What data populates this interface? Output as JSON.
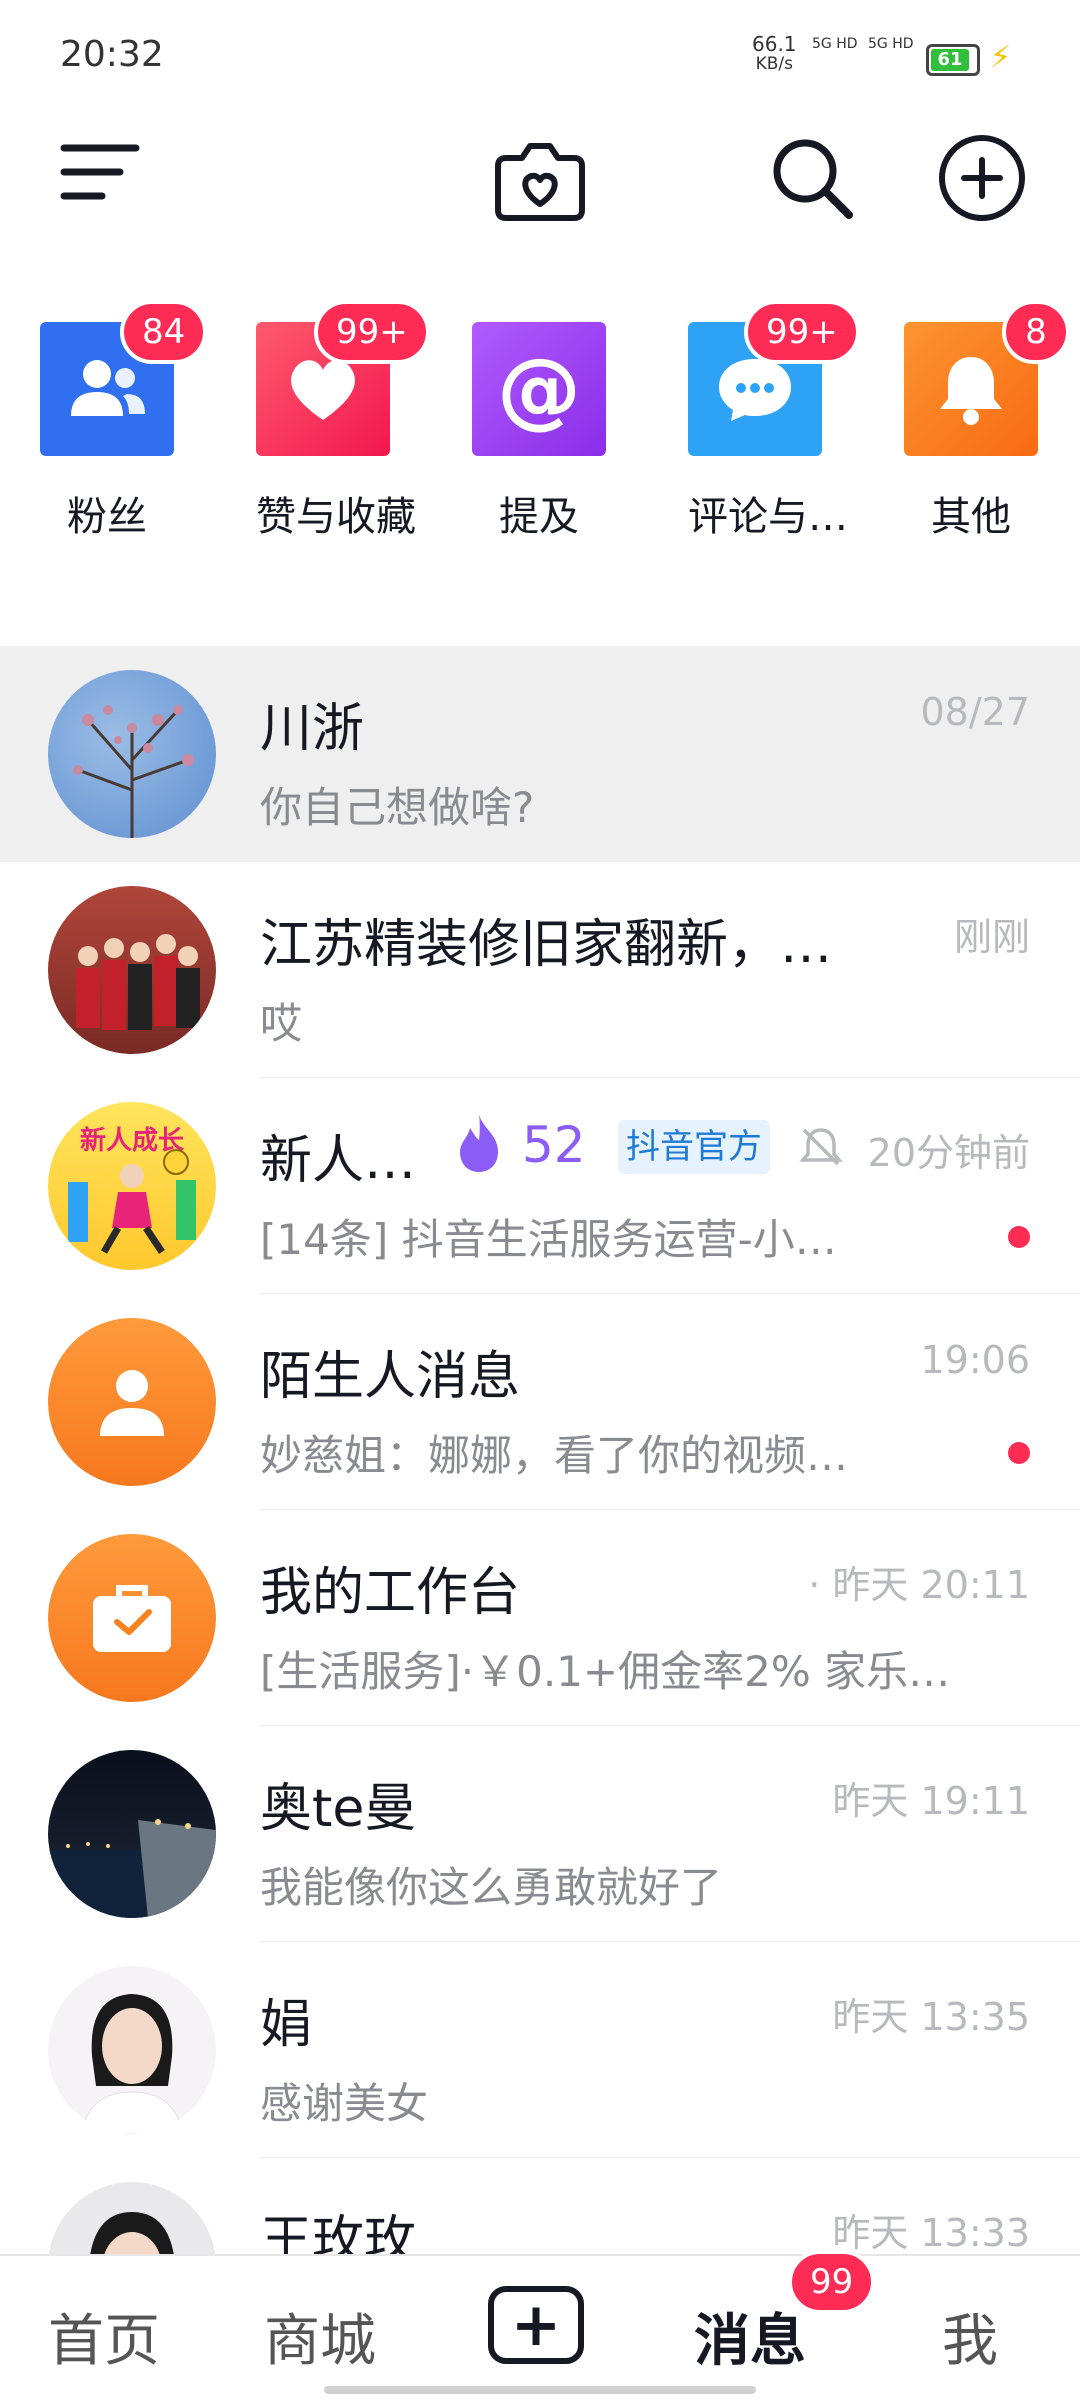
{
  "status_bar": {
    "time": "20:32",
    "net_speed_value": "66.1",
    "net_speed_unit": "KB/s",
    "sim1": "5G HD",
    "sim2": "5G HD",
    "battery": "61"
  },
  "categories": [
    {
      "label": "粉丝",
      "badge": "84",
      "color": "#2f6ff0",
      "icon": "fans-icon"
    },
    {
      "label": "赞与收藏",
      "badge": "99+",
      "color": "#fb3b62",
      "icon": "heart-icon"
    },
    {
      "label": "提及",
      "badge": "",
      "color": "#9b3ff2",
      "icon": "at-icon"
    },
    {
      "label": "评论与…",
      "badge": "99+",
      "color": "#2ea2f5",
      "icon": "comment-icon"
    },
    {
      "label": "其他",
      "badge": "8",
      "color": "#f97e1f",
      "icon": "bell-icon"
    }
  ],
  "messages": [
    {
      "name": "川浙",
      "time": "08/27",
      "preview": "你自己想做啥?"
    },
    {
      "name": "江苏精装修旧家翻新，…",
      "time": "刚刚",
      "preview": "哎"
    },
    {
      "name": "新人…",
      "level": "52",
      "tag": "抖音官方",
      "time": "20分钟前",
      "preview": "[14条] 抖音生活服务运营-小…",
      "avatar_text": "新人成长"
    },
    {
      "name": "陌生人消息",
      "time": "19:06",
      "preview": "妙慈姐：娜娜，看了你的视频…"
    },
    {
      "name": "我的工作台",
      "time": "· 昨天 20:11",
      "preview": "[生活服务]·￥0.1+佣金率2% 家乐…"
    },
    {
      "name": "奥te曼",
      "time": "昨天 19:11",
      "preview": "我能像你这么勇敢就好了"
    },
    {
      "name": "娟",
      "time": "昨天 13:35",
      "preview": "感谢美女"
    },
    {
      "name": "王玫玫",
      "time": "昨天 13:33",
      "preview": ""
    }
  ],
  "nav": {
    "home": "首页",
    "mall": "商城",
    "messages": "消息",
    "messages_badge": "99",
    "me": "我"
  }
}
